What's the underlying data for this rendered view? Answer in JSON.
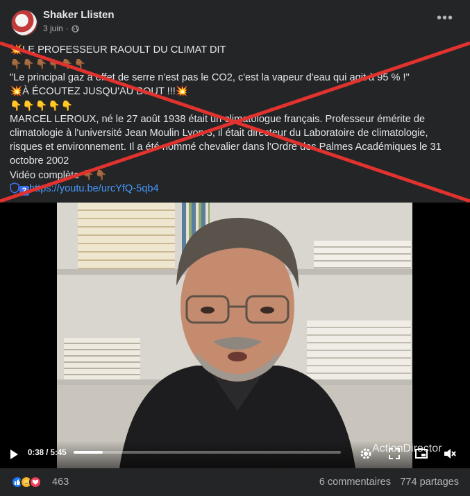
{
  "header": {
    "author": "Shaker Llisten",
    "date": "3 juin",
    "more": "•••"
  },
  "post": {
    "line1_title": "LE PROFESSEUR RAOULT DU CLIMAT DIT",
    "quote": "\"Le principal gaz à effet de serre n'est pas le CO2, c'est  la vapeur d'eau qui agit à 95 % !\"",
    "listen": "À ÉCOUTEZ JUSQU'AU BOUT !!!",
    "bio": "MARCEL LEROUX, né le 27 août 1938 était un climatologue français. Professeur émérite de climatologie à l'université Jean Moulin Lyon 3, il était directeur du Laboratoire de climatologie, risques et environnement. Il a été nommé chevalier dans l'Ordre des Palmes Académiques le 31 octobre 2002",
    "full_video": "Vidéo complète",
    "link": "https://youtu.be/urcYfQ-5qb4",
    "qmark": "?"
  },
  "video": {
    "time": "0:38 / 5:45",
    "progress": 0.11,
    "watermark": "ActionDirector"
  },
  "footer": {
    "reaction_count": "463",
    "comments": "6 commentaires",
    "shares": "774 partages"
  },
  "colors": {
    "background": "#242526",
    "text": "#e4e6eb",
    "secondary": "#b0b3b8",
    "link": "#4599ff",
    "cross": "#e0322f"
  }
}
